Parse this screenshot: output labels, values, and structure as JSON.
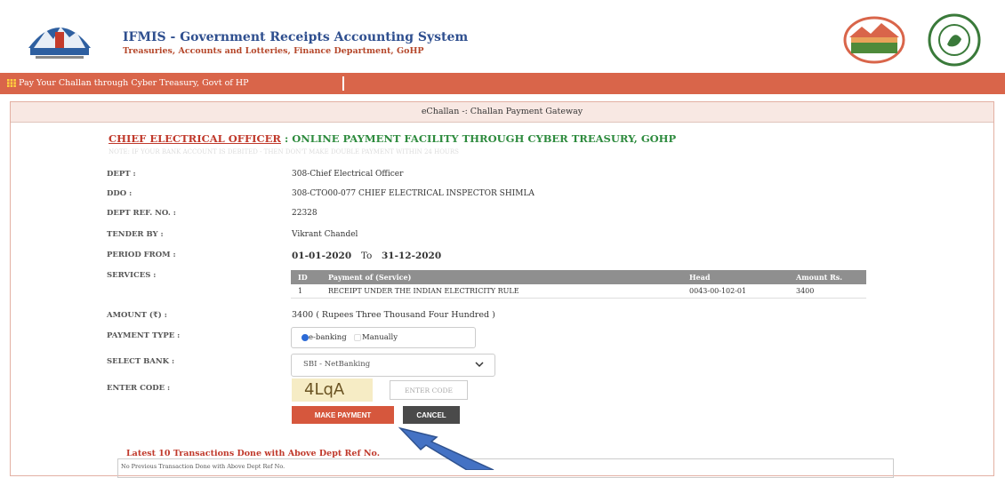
{
  "header": {
    "title": "IFMIS - Government Receipts Accounting System",
    "subtitle": "Treasuries, Accounts and Lotteries, Finance Department, GoHP",
    "logos": [
      "state-emblem",
      "echallan-logo",
      "treasury-seal"
    ]
  },
  "nav": {
    "icon": "grid-icon",
    "text": "Pay Your Challan through Cyber Treasury, Govt of HP"
  },
  "panel": {
    "title": "eChallan -: Challan Payment Gateway"
  },
  "heading": {
    "link": "CHIEF ELECTRICAL OFFICER",
    "rest": " : ONLINE PAYMENT FACILITY THROUGH CYBER TREASURY, GOHP",
    "notice": "NOTE: IF YOUR BANK ACCOUNT IS DEBITED - THEN DON'T MAKE DOUBLE PAYMENT WITHIN 24 HOURS"
  },
  "fields": {
    "dept_label": "DEPT :",
    "dept_value": "308-Chief Electrical Officer",
    "ddo_label": "DDO :",
    "ddo_value": "308-CTO00-077 CHIEF ELECTRICAL INSPECTOR SHIMLA",
    "ref_label": "DEPT REF. NO. :",
    "ref_value": "22328",
    "tender_label": "TENDER BY :",
    "tender_value": "Vikrant Chandel",
    "period_label": "PERIOD FROM :",
    "period_from": "01-01-2020",
    "period_to_word": "To",
    "period_to": "31-12-2020",
    "services_label": "SERVICES :",
    "amount_label": "AMOUNT (₹) :",
    "amount_value": "3400 ( Rupees Three Thousand Four Hundred )",
    "ptype_label": "PAYMENT TYPE :",
    "bank_label": "SELECT BANK :",
    "code_label": "ENTER CODE :"
  },
  "services": {
    "headers": [
      "ID",
      "Payment of (Service)",
      "Head",
      "Amount Rs."
    ],
    "rows": [
      [
        "1",
        "RECEIPT UNDER THE INDIAN ELECTRICITY RULE",
        "0043-00-102-01",
        "3400"
      ]
    ]
  },
  "payment_type": {
    "options": [
      "e-banking",
      "Manually"
    ],
    "selected": "e-banking"
  },
  "bank": {
    "selected": "SBI - NetBanking"
  },
  "captcha": {
    "text": "4LqA",
    "placeholder": "ENTER CODE"
  },
  "buttons": {
    "pay": "MAKE PAYMENT",
    "cancel": "CANCEL"
  },
  "transactions": {
    "title": "Latest 10 Transactions Done with Above Dept Ref No.",
    "empty": "No Previous Transaction Done with Above Dept Ref No."
  },
  "colors": {
    "nav": "#d9654a",
    "heading_link": "#c0392b",
    "heading_text": "#2e8b3e",
    "pay_button": "#d6573d",
    "cancel_button": "#4a4a4a",
    "arrow": "#4472c4"
  }
}
